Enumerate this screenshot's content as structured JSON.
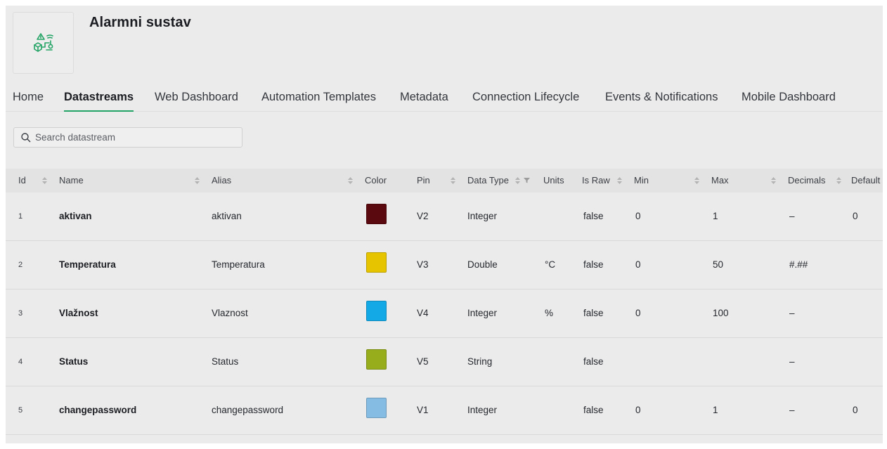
{
  "header": {
    "title": "Alarmni sustav",
    "logo_icon": "alarm-system-icon",
    "accent_color": "#23a365"
  },
  "tabs": [
    {
      "label": "Home",
      "active": false
    },
    {
      "label": "Datastreams",
      "active": true
    },
    {
      "label": "Web Dashboard",
      "active": false
    },
    {
      "label": "Automation Templates",
      "active": false
    },
    {
      "label": "Metadata",
      "active": false
    },
    {
      "label": "Connection Lifecycle",
      "active": false
    },
    {
      "label": "Events & Notifications",
      "active": false
    },
    {
      "label": "Mobile Dashboard",
      "active": false
    }
  ],
  "search": {
    "placeholder": "Search datastream",
    "value": ""
  },
  "table": {
    "columns": [
      "Id",
      "Name",
      "Alias",
      "Color",
      "Pin",
      "Data Type",
      "Units",
      "Is Raw",
      "Min",
      "Max",
      "Decimals",
      "Default"
    ],
    "rows": [
      {
        "id": "1",
        "name": "aktivan",
        "alias": "aktivan",
        "color": "#5a0a0f",
        "pin": "V2",
        "data_type": "Integer",
        "units": "",
        "is_raw": "false",
        "min": "0",
        "max": "1",
        "decimals": "–",
        "default": "0"
      },
      {
        "id": "2",
        "name": "Temperatura",
        "alias": "Temperatura",
        "color": "#e6c400",
        "pin": "V3",
        "data_type": "Double",
        "units": "°C",
        "is_raw": "false",
        "min": "0",
        "max": "50",
        "decimals": "#.##",
        "default": ""
      },
      {
        "id": "3",
        "name": "Vlažnost",
        "alias": "Vlaznost",
        "color": "#13a9e6",
        "pin": "V4",
        "data_type": "Integer",
        "units": "%",
        "is_raw": "false",
        "min": "0",
        "max": "100",
        "decimals": "–",
        "default": ""
      },
      {
        "id": "4",
        "name": "Status",
        "alias": "Status",
        "color": "#97ad1c",
        "pin": "V5",
        "data_type": "String",
        "units": "",
        "is_raw": "false",
        "min": "",
        "max": "",
        "decimals": "–",
        "default": ""
      },
      {
        "id": "5",
        "name": "changepassword",
        "alias": "changepassword",
        "color": "#84bce3",
        "pin": "V1",
        "data_type": "Integer",
        "units": "",
        "is_raw": "false",
        "min": "0",
        "max": "1",
        "decimals": "–",
        "default": "0"
      }
    ]
  }
}
